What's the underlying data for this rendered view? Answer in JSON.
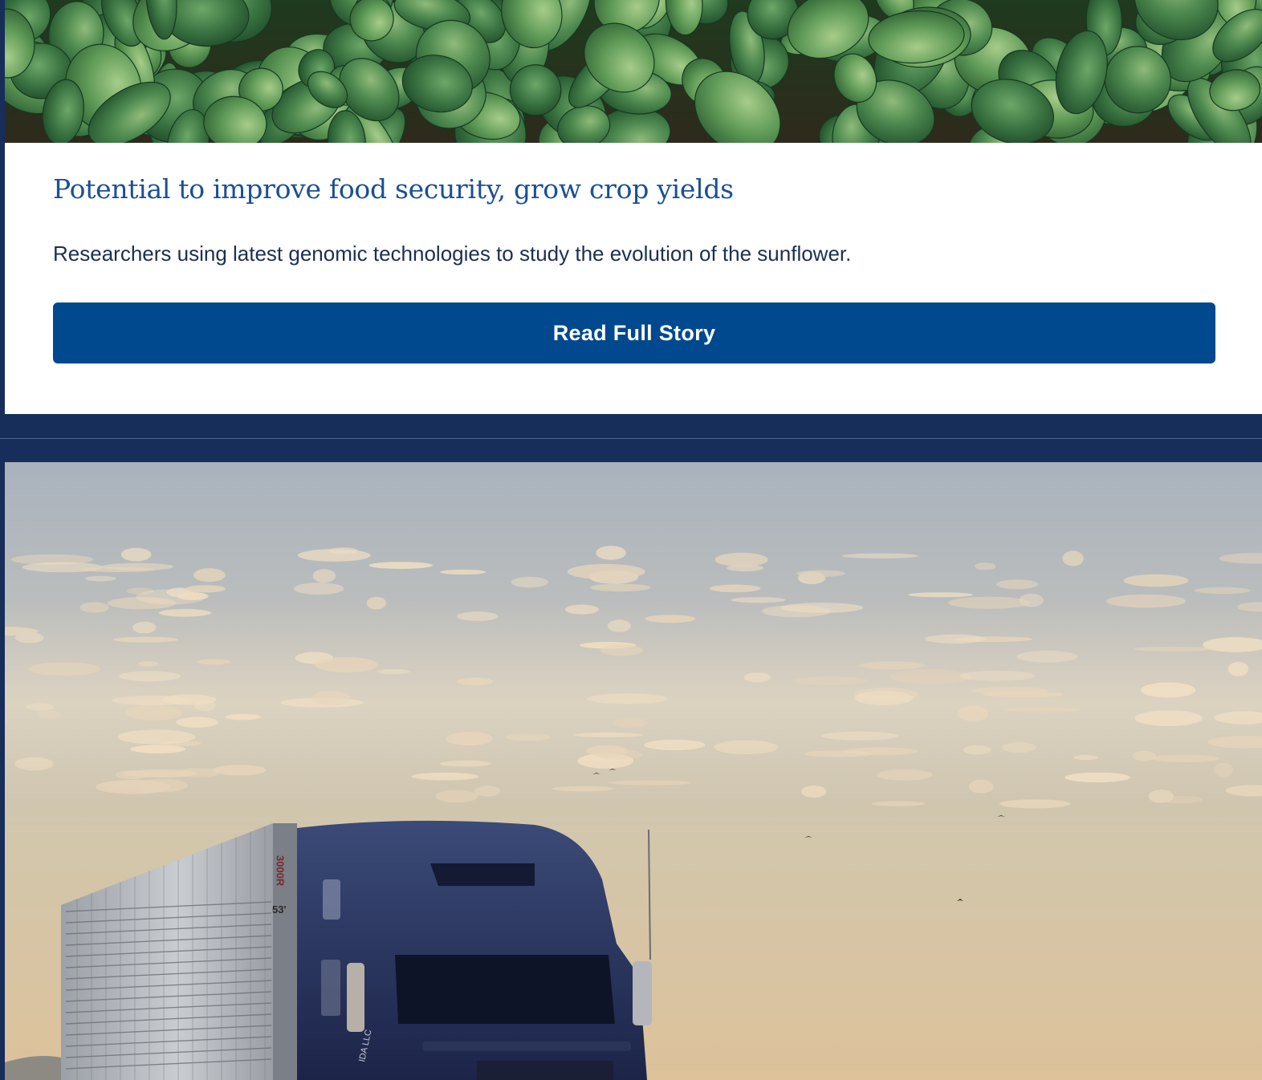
{
  "stories": [
    {
      "headline": "Potential to improve food security, grow crop yields",
      "summary": "Researchers using latest genomic technologies to study the evolution of the sunflower.",
      "cta_label": "Read Full Story",
      "image": "leafy-crop-field-photo"
    },
    {
      "image": "semi-truck-sunset-sky-photo"
    }
  ],
  "truck": {
    "trailer_marks": [
      "3000R",
      "53'"
    ],
    "cab_lettering": "IDA LLC"
  },
  "colors": {
    "page_background": "#172d5a",
    "headline": "#1a4f95",
    "body_text": "#1c2f52",
    "button": "#00498e",
    "button_text": "#ffffff"
  }
}
